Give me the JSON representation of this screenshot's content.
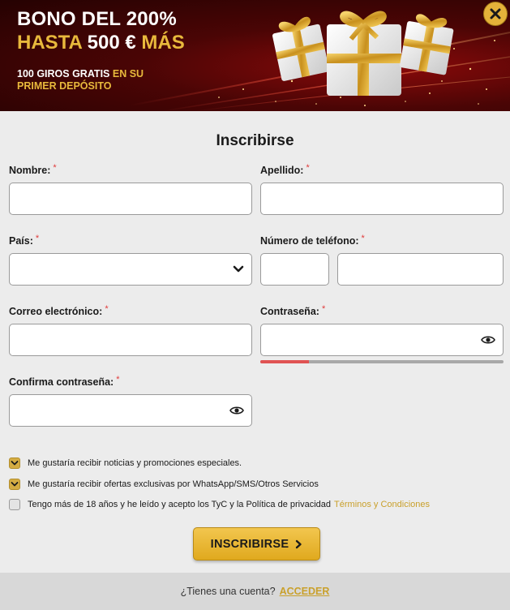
{
  "banner": {
    "line1": "BONO DEL 200%",
    "line2_gold_a": "HASTA",
    "line2_white": "500 €",
    "line2_gold_b": "MÁS",
    "line3_white": "100 GIROS GRATIS",
    "line3_gold": "EN SU",
    "line3_gold_b": "PRIMER DEPÓSITO"
  },
  "form": {
    "title": "Inscribirse",
    "required_mark": "*",
    "fields": {
      "first_name": {
        "label": "Nombre:",
        "value": ""
      },
      "last_name": {
        "label": "Apellido:",
        "value": ""
      },
      "country": {
        "label": "País:",
        "value": ""
      },
      "phone": {
        "label": "Número de teléfono:",
        "prefix": "",
        "value": ""
      },
      "email": {
        "label": "Correo electrónico:",
        "value": ""
      },
      "password": {
        "label": "Contraseña:",
        "value": "",
        "strength": 0.2
      },
      "confirm_password": {
        "label": "Confirma contraseña:",
        "value": ""
      }
    },
    "checkboxes": [
      {
        "label": "Me gustaría recibir noticias y promociones especiales.",
        "checked": true
      },
      {
        "label": "Me gustaría recibir ofertas exclusivas por WhatsApp/SMS/Otros Servicios",
        "checked": true
      },
      {
        "label": "Tengo más de 18 años y he leído y acepto los TyC y la Política de privacidad",
        "checked": false,
        "link": "Términos y Condiciones"
      }
    ],
    "submit_label": "INSCRIBIRSE"
  },
  "footer": {
    "question": "¿Tienes una cuenta?",
    "login_label": "ACCEDER"
  },
  "colors": {
    "accent_gold": "#e0a91e",
    "banner_red": "#4a0505",
    "required_red": "#e03a3a",
    "strength_fill": "#e05353"
  },
  "icons": {
    "close": "close-icon",
    "select_chevron": "chevron-down-icon",
    "password_toggle": "eye-icon",
    "submit_chevron": "chevron-right-icon",
    "check": "check-icon"
  }
}
